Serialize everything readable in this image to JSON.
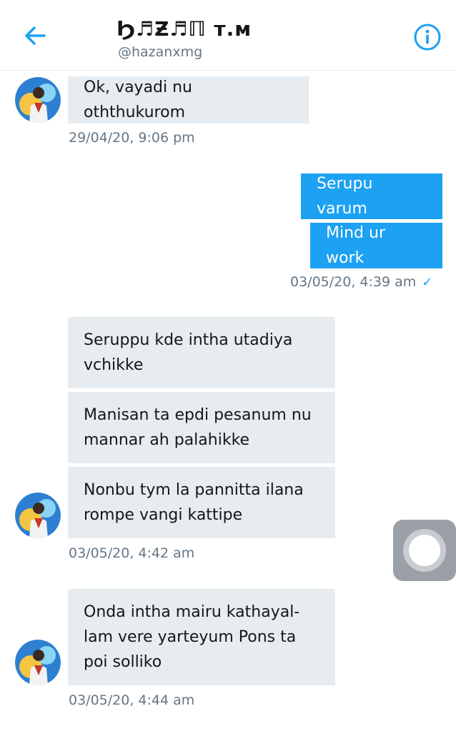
{
  "header": {
    "title": "Ϧ♬Ƶ♬ℿ т.м",
    "handle": "@hazanxmg"
  },
  "colors": {
    "accent": "#1da1f2",
    "incoming_bubble": "#e6ecf0",
    "timestamp": "#657786"
  },
  "messages": {
    "m1": {
      "text": "Ok, vayadi nu oththukurom",
      "time": "29/04/20, 9:06 pm"
    },
    "m2": {
      "text": "Serupu varum"
    },
    "m3": {
      "text": "Mind ur work",
      "time": "03/05/20, 4:39 am",
      "status_icon": "check-icon"
    },
    "m4": {
      "line1": "Seruppu kde intha utadiya",
      "line2": "vchikke"
    },
    "m5": {
      "line1": "Manisan ta epdi pesanum nu",
      "line2": "mannar ah palahikke"
    },
    "m6": {
      "line1": "Nonbu tym la pannitta ilana",
      "line2": "rompe vangi kattipe",
      "time": "03/05/20, 4:42 am"
    },
    "m7": {
      "line1": "Onda intha mairu kathayal-",
      "line2": "lam vere yarteyum Pons ta",
      "line3": "poi solliko",
      "time": "03/05/20, 4:44 am"
    }
  },
  "icons": {
    "back": "back-arrow-icon",
    "info": "info-icon",
    "check": "check-icon",
    "assistive_touch": "assistive-touch-icon"
  }
}
